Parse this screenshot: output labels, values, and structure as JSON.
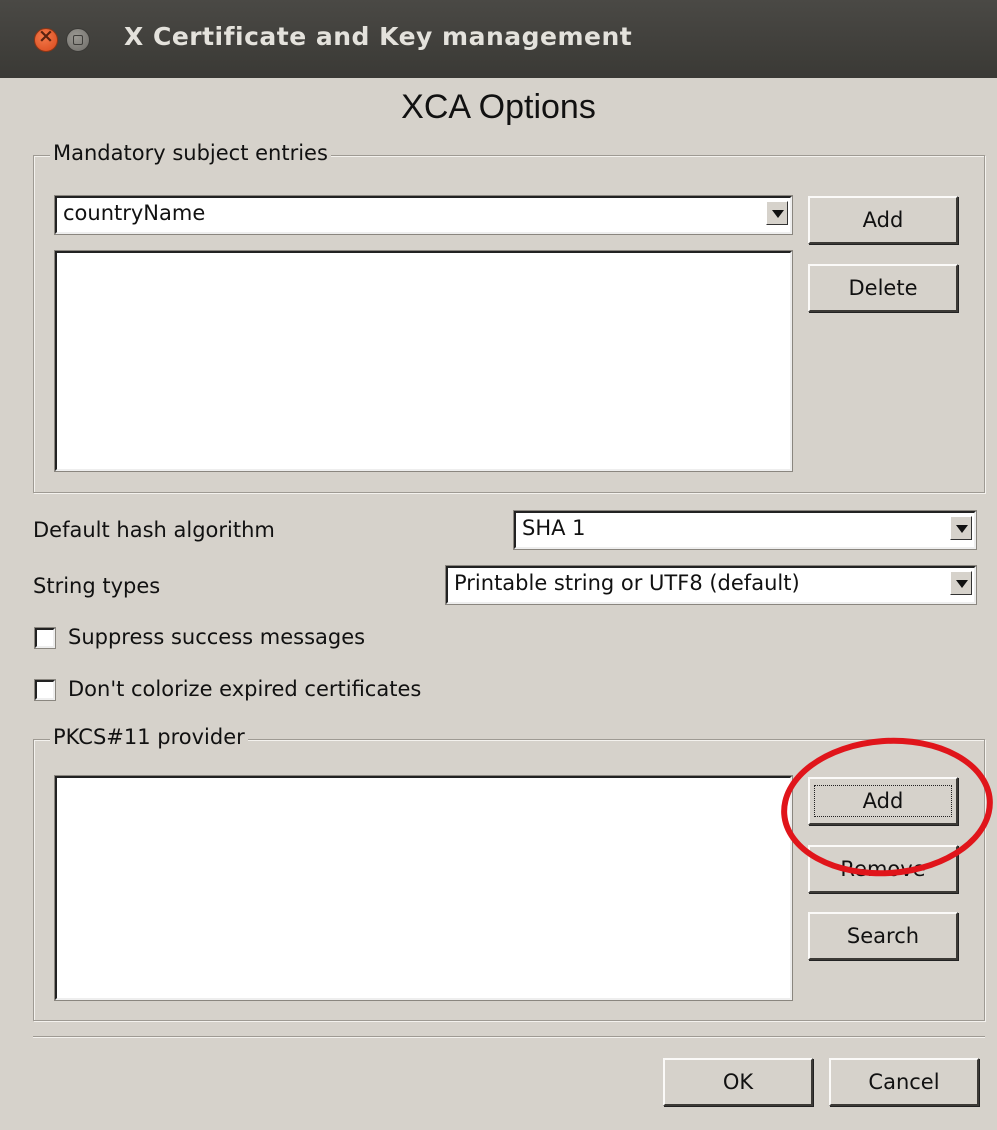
{
  "window": {
    "title": "X Certificate and Key management",
    "close_icon": "close-icon",
    "minimize_icon": "minimize-icon"
  },
  "dialog": {
    "heading": "XCA Options"
  },
  "mandatory_subject": {
    "legend": "Mandatory subject entries",
    "combo_value": "countryName",
    "add_label": "Add",
    "delete_label": "Delete",
    "entries": []
  },
  "hash": {
    "label": "Default hash algorithm",
    "value": "SHA 1"
  },
  "string_types": {
    "label": "String types",
    "value": "Printable string or UTF8 (default)"
  },
  "checkboxes": {
    "suppress_label": "Suppress success messages",
    "suppress_checked": false,
    "colorize_label": "Don't colorize expired certificates",
    "colorize_checked": false
  },
  "pkcs11": {
    "legend": "PKCS#11 provider",
    "add_label": "Add",
    "remove_label": "Remove",
    "search_label": "Search",
    "providers": []
  },
  "footer": {
    "ok_label": "OK",
    "cancel_label": "Cancel"
  },
  "annotation": {
    "color": "#e0151b",
    "shape": "ellipse around PKCS#11 Add button"
  }
}
